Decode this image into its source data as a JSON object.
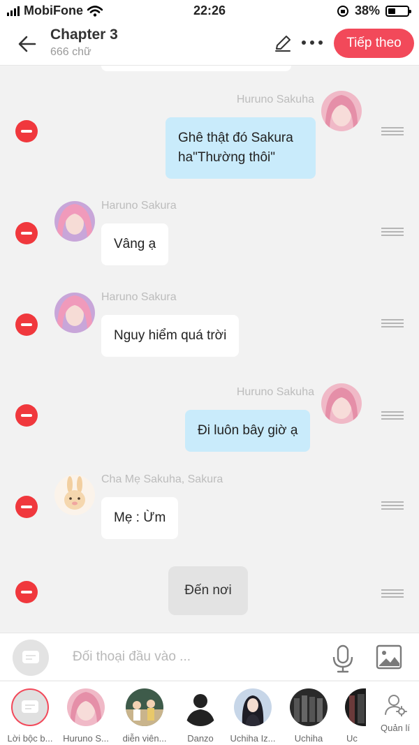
{
  "status_bar": {
    "carrier": "MobiFone",
    "time": "22:26",
    "battery_text": "38%",
    "battery_level": 0.38
  },
  "header": {
    "title": "Chapter 3",
    "subtitle": "666 chữ",
    "next_label": "Tiếp theo"
  },
  "messages": [
    {
      "side": "right",
      "name": "Huruno Sakuha",
      "lines": [
        "Ghê thật đó Sakura",
        "ha\"Thường thôi\""
      ]
    },
    {
      "side": "left",
      "name": "Haruno Sakura",
      "text": "Vâng ạ"
    },
    {
      "side": "left",
      "name": "Haruno Sakura",
      "text": "Nguy hiểm quá trời"
    },
    {
      "side": "right",
      "name": "Huruno Sakuha",
      "text": "Đi luôn bây giờ ạ"
    },
    {
      "side": "left",
      "name": "Cha Mẹ Sakuha, Sakura",
      "text": "Mẹ : Ừm"
    },
    {
      "side": "center",
      "text": "Đến nơi"
    }
  ],
  "input": {
    "placeholder": "Đối thoại đầu vào ..."
  },
  "characters": [
    {
      "name": "Lời bộc b..."
    },
    {
      "name": "Huruno S..."
    },
    {
      "name": "diễn viên..."
    },
    {
      "name": "Danzo"
    },
    {
      "name": "Uchiha Iz..."
    },
    {
      "name": "Uchiha"
    },
    {
      "name": "Uc"
    }
  ],
  "manage_label": "Quản lí",
  "colors": {
    "accent": "#f2495a",
    "delete": "#f0383d",
    "bubble_right": "#c9ebfb"
  },
  "icons": [
    "back-arrow-icon",
    "pencil-icon",
    "more-icon",
    "minus-icon",
    "drag-handle-icon",
    "mic-icon",
    "image-icon",
    "manage-user-icon",
    "wifi-icon"
  ]
}
